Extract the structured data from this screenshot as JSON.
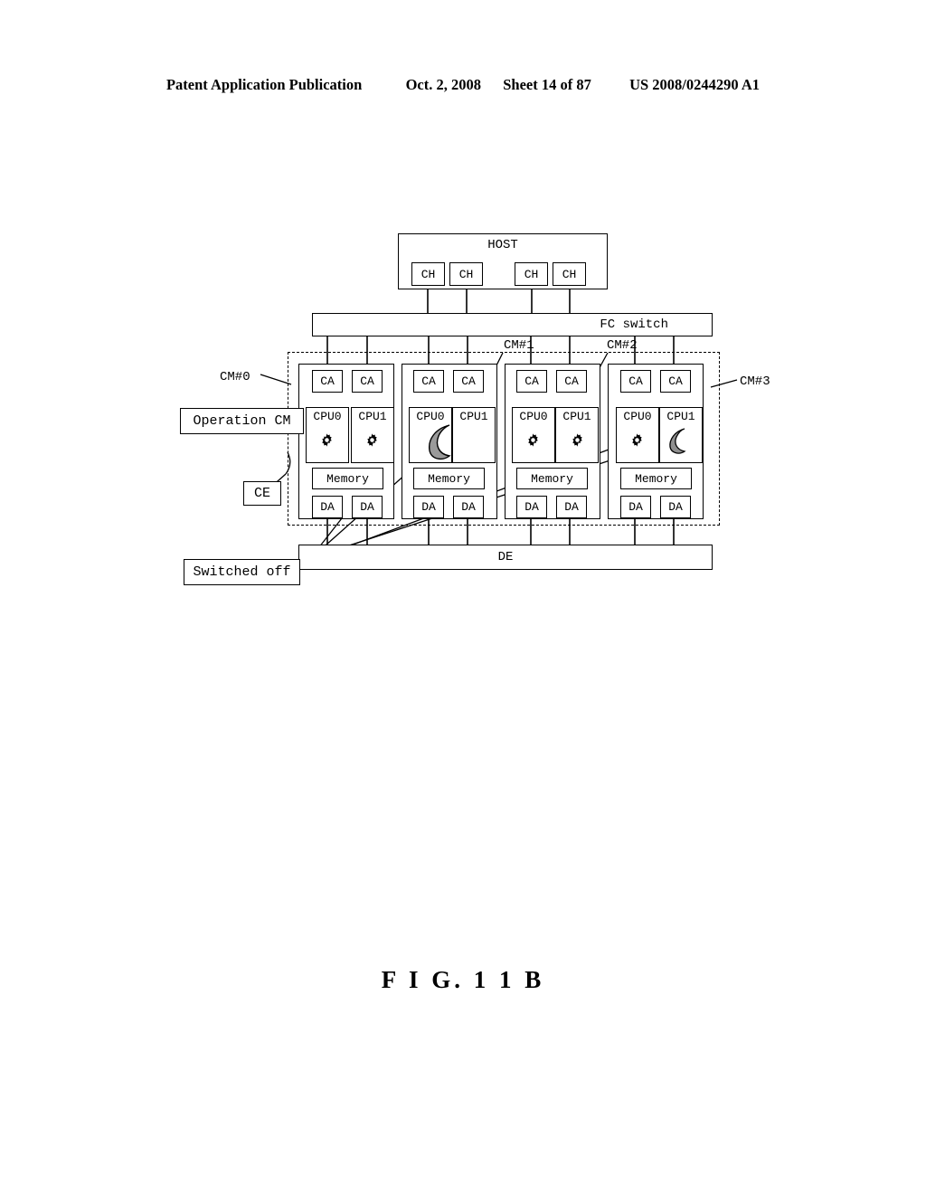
{
  "header": {
    "publication": "Patent Application Publication",
    "date": "Oct. 2, 2008",
    "sheet": "Sheet 14 of 87",
    "docnum": "US 2008/0244290 A1"
  },
  "figure": {
    "caption": "F I G.  1 1 B"
  },
  "diagram": {
    "host": {
      "title": "HOST",
      "channels": [
        "CH",
        "CH",
        "CH",
        "CH"
      ]
    },
    "switch": {
      "label": "FC switch"
    },
    "enclosure": {
      "label": "DE"
    },
    "cm_tags": {
      "cm0": "CM#0",
      "cm1": "CM#1",
      "cm2": "CM#2",
      "cm3": "CM#3"
    },
    "callouts": {
      "operation_cm": "Operation CM",
      "ce": "CE",
      "switched_off": "Switched off"
    },
    "modules": [
      {
        "name": "CM#0",
        "ca": [
          "CA",
          "CA"
        ],
        "cpu": [
          "CPU0",
          "CPU1"
        ],
        "memory": "Memory",
        "da": [
          "DA",
          "DA"
        ],
        "cpu0_state": "gear",
        "cpu1_state": "gear"
      },
      {
        "name": "CM#1",
        "ca": [
          "CA",
          "CA"
        ],
        "cpu": [
          "CPU0",
          "CPU1"
        ],
        "memory": "Memory",
        "da": [
          "DA",
          "DA"
        ],
        "cpu0_state": "moon",
        "cpu1_state": "off"
      },
      {
        "name": "CM#2",
        "ca": [
          "CA",
          "CA"
        ],
        "cpu": [
          "CPU0",
          "CPU1"
        ],
        "memory": "Memory",
        "da": [
          "DA",
          "DA"
        ],
        "cpu0_state": "gear",
        "cpu1_state": "gear"
      },
      {
        "name": "CM#3",
        "ca": [
          "CA",
          "CA"
        ],
        "cpu": [
          "CPU0",
          "CPU1"
        ],
        "memory": "Memory",
        "da": [
          "DA",
          "DA"
        ],
        "cpu0_state": "gear",
        "cpu1_state": "moon"
      }
    ]
  }
}
